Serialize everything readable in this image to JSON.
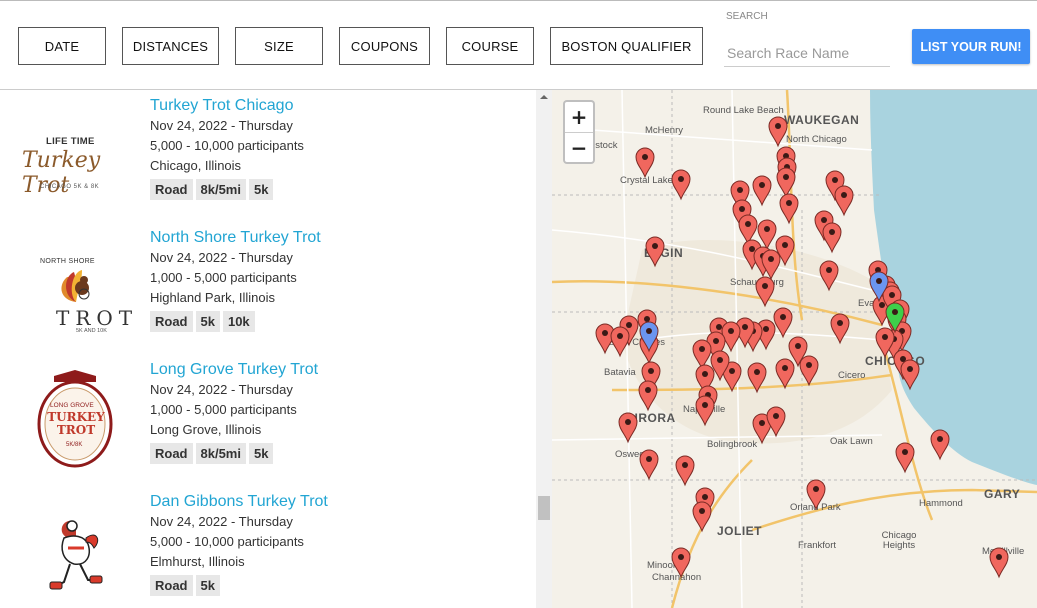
{
  "filters": [
    "DATE",
    "DISTANCES",
    "SIZE",
    "COUPONS",
    "COURSE",
    "BOSTON QUALIFIER"
  ],
  "search": {
    "label": "SEARCH",
    "placeholder": "Search Race Name"
  },
  "list_button": "LIST YOUR RUN!",
  "races": [
    {
      "name": "Turkey Trot Chicago",
      "date": "Nov 24, 2022 - Thursday",
      "participants": "5,000 - 10,000 participants",
      "location": "Chicago, Illinois",
      "tags": [
        "Road",
        "8k/5mi",
        "5k"
      ],
      "logo": {
        "top": "LIFE TIME",
        "main": "Turkey Trot",
        "sub": "CHICAGO 5K & 8K"
      }
    },
    {
      "name": "North Shore Turkey Trot",
      "date": "Nov 24, 2022 - Thursday",
      "participants": "1,000 - 5,000 participants",
      "location": "Highland Park, Illinois",
      "tags": [
        "Road",
        "5k",
        "10k"
      ],
      "logo": {
        "top": "NORTH SHORE",
        "main": "TROT",
        "sub": "5K AND 10K"
      }
    },
    {
      "name": "Long Grove Turkey Trot",
      "date": "Nov 24, 2022 - Thursday",
      "participants": "1,000 - 5,000 participants",
      "location": "Long Grove, Illinois",
      "tags": [
        "Road",
        "8k/5mi",
        "5k"
      ],
      "logo": {
        "top": "LONG GROVE",
        "main": "TURKEY TROT",
        "sub": "5K/8K"
      }
    },
    {
      "name": "Dan Gibbons Turkey Trot",
      "date": "Nov 24, 2022 - Thursday",
      "participants": "5,000 - 10,000 participants",
      "location": "Elmhurst, Illinois",
      "tags": [
        "Road",
        "5k"
      ],
      "logo": {
        "top": "",
        "main": "",
        "sub": ""
      }
    }
  ],
  "map": {
    "zoom_in": "+",
    "zoom_out": "−",
    "places": [
      {
        "name": "Round Lake Beach",
        "kind": "small"
      },
      {
        "name": "WAUKEGAN",
        "kind": "city"
      },
      {
        "name": "North Chicago",
        "kind": "small"
      },
      {
        "name": "McHenry",
        "kind": "small"
      },
      {
        "name": "dstock",
        "kind": "small"
      },
      {
        "name": "Crystal Lake",
        "kind": "small"
      },
      {
        "name": "ELGIN",
        "kind": "city"
      },
      {
        "name": "Schaumburg",
        "kind": "small"
      },
      {
        "name": "Evanston",
        "kind": "small"
      },
      {
        "name": "Saint Charles",
        "kind": "small"
      },
      {
        "name": "Batavia",
        "kind": "small"
      },
      {
        "name": "CHICAGO",
        "kind": "city"
      },
      {
        "name": "Cicero",
        "kind": "small"
      },
      {
        "name": "AURORA",
        "kind": "city"
      },
      {
        "name": "Naperville",
        "kind": "small"
      },
      {
        "name": "Bolingbrook",
        "kind": "small"
      },
      {
        "name": "Oak Lawn",
        "kind": "small"
      },
      {
        "name": "Oswego",
        "kind": "small"
      },
      {
        "name": "Hammond",
        "kind": "small"
      },
      {
        "name": "GARY",
        "kind": "city"
      },
      {
        "name": "Orland Park",
        "kind": "small"
      },
      {
        "name": "JOLIET",
        "kind": "city"
      },
      {
        "name": "Frankfort",
        "kind": "small"
      },
      {
        "name": "Chicago Heights",
        "kind": "small"
      },
      {
        "name": "Minooka",
        "kind": "small"
      },
      {
        "name": "Channahon",
        "kind": "small"
      },
      {
        "name": "Merrillville",
        "kind": "small"
      }
    ],
    "colors": {
      "pin_red": "#f0675e",
      "pin_blue": "#6b95f0",
      "pin_green": "#3ecf4a",
      "water": "#a9d3df",
      "land": "#f4f1e9"
    }
  }
}
